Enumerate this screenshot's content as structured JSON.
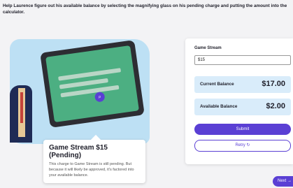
{
  "instructions": "Help Laurence figure out his available balance by selecting the magnifying glass on his pending charge and putting the amount into the calculator.",
  "callout": {
    "title": "Game Stream $15 (Pending)",
    "body": "This charge to Game Stream is still pending. But because it will likely be approved, it's factored into your available balance."
  },
  "calculator": {
    "field_label": "Game Stream",
    "field_value": "$15",
    "current_balance_label": "Current Balance",
    "current_balance_value": "$17.00",
    "available_balance_label": "Available Balance",
    "available_balance_value": "$2.00",
    "submit_label": "Submit",
    "retry_label": "Retry",
    "retry_icon": "refresh-icon"
  },
  "next_label": "Next",
  "next_icon": "arrow-right-icon",
  "colors": {
    "accent": "#5a3fd4",
    "balance_bg": "#d9ecfa",
    "illustration_bg": "#bde0f4"
  }
}
